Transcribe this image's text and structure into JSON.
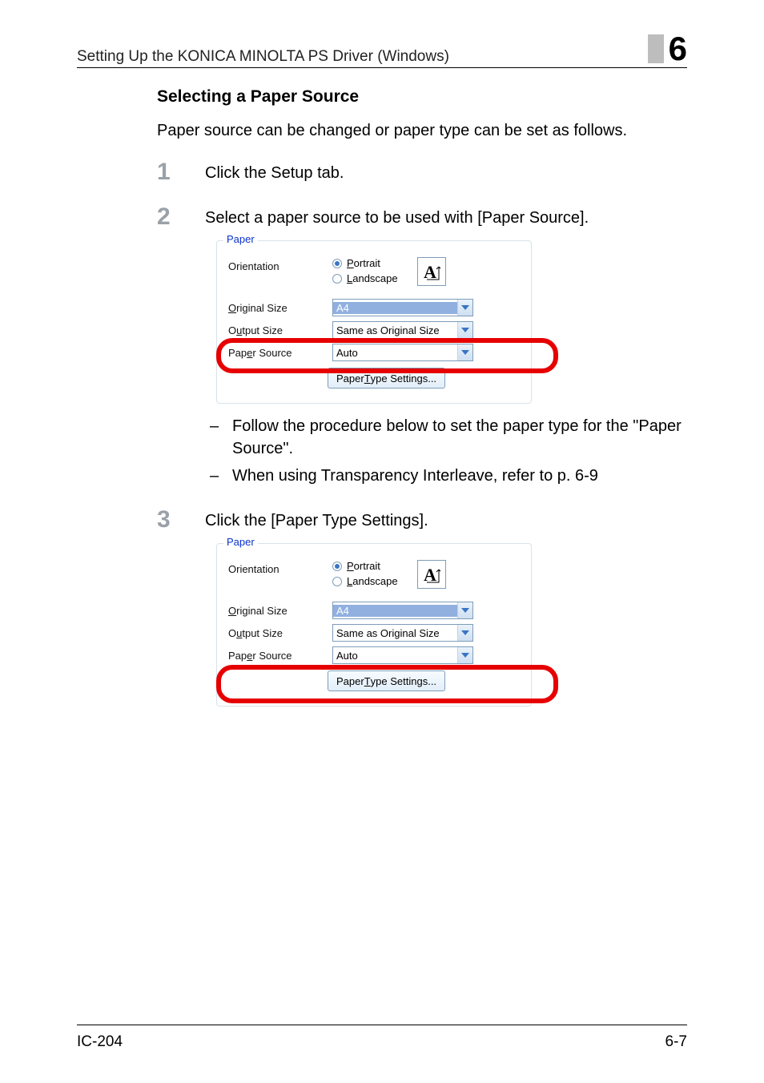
{
  "running_head": "Setting Up the KONICA MINOLTA PS Driver (Windows)",
  "chapter_number": "6",
  "heading": "Selecting a Paper Source",
  "intro": "Paper source can be changed or paper type can be set as follows.",
  "steps": [
    {
      "num": "1",
      "text": "Click the Setup tab."
    },
    {
      "num": "2",
      "text": "Select a paper source to be used with [Paper Source]."
    },
    {
      "num": "3",
      "text": "Click the [Paper Type Settings]."
    }
  ],
  "sub_points": [
    "Follow the procedure below to set the paper type for the \"Paper Source\".",
    "When using Transparency Interleave, refer to p. 6-9"
  ],
  "dialog": {
    "legend": "Paper",
    "labels": {
      "orientation": "Orientation",
      "original_size": "Original Size",
      "output_size": "Output Size",
      "paper_source": "Paper Source"
    },
    "underline_chars": {
      "original_size": "O",
      "output_size": "u",
      "paper_source": "e",
      "portrait": "P",
      "landscape": "L",
      "paper_type_btn": "T"
    },
    "radios": {
      "portrait": "Portrait",
      "landscape": "Landscape"
    },
    "original_size_value": "A4",
    "output_size_value": "Same as Original Size",
    "paper_source_value": "Auto",
    "paper_type_button": "Paper Type Settings..."
  },
  "footer": {
    "left": "IC-204",
    "right": "6-7"
  }
}
